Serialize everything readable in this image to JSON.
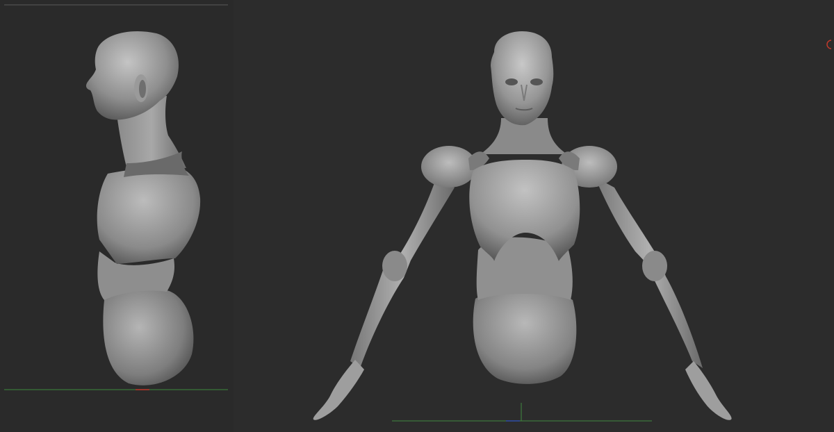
{
  "app": {
    "theme": {
      "background": "#2b2b2b",
      "model_light": "#bdbdbd",
      "model_mid": "#8e8e8e",
      "model_dark": "#4a4a4a",
      "axis_x_color": "#3f8a3f",
      "axis_y_color": "#3f8a3f",
      "axis_z_color": "#2f4fa8",
      "axis_red_color": "#c0392b"
    }
  },
  "viewports": {
    "side": {
      "icon": "mannequin-side-view-icon"
    },
    "front": {
      "icon": "mannequin-front-view-icon"
    }
  }
}
